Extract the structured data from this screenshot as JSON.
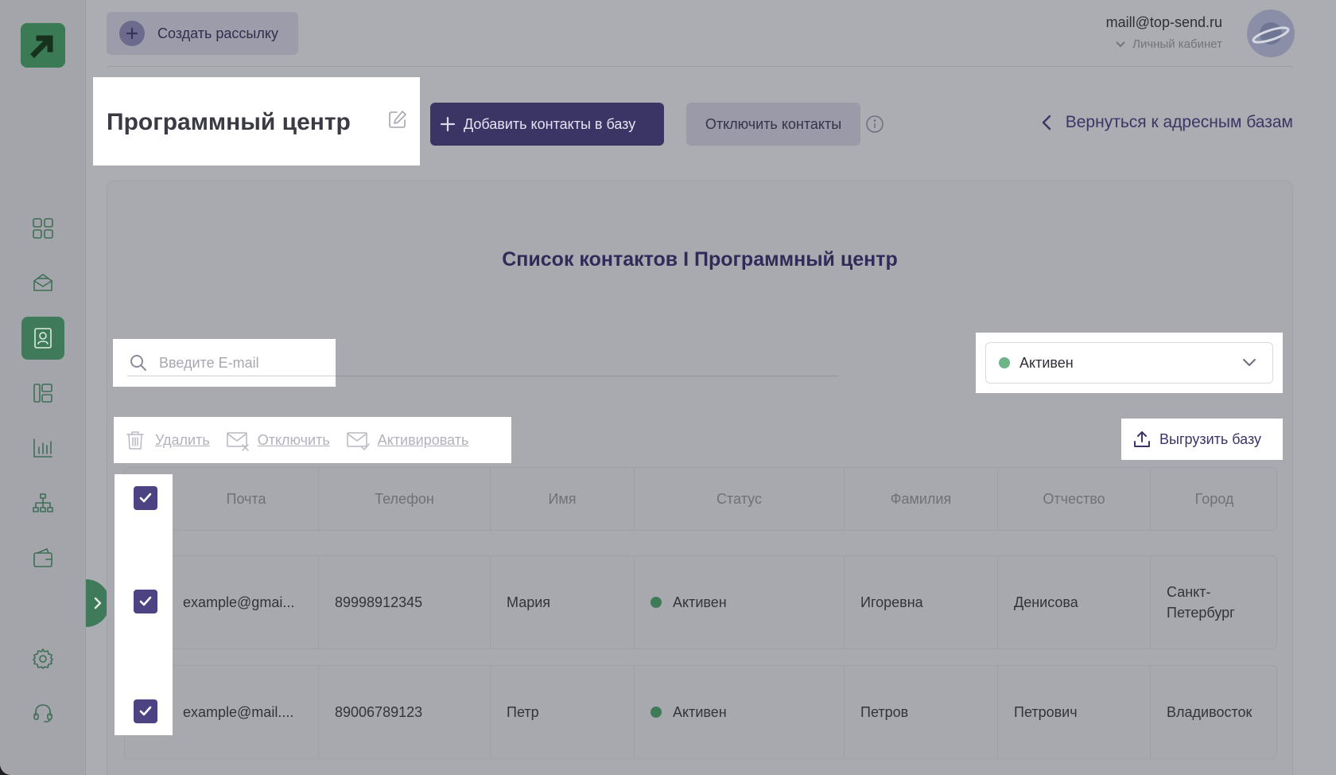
{
  "header": {
    "create_button": "Создать рассылку",
    "user_email": "maill@top-send.ru",
    "cabinet_label": "Личный кабинет"
  },
  "page": {
    "title": "Программный центр",
    "add_button": "Добавить контакты в базу",
    "disable_button": "Отключить контакты",
    "back_link": "Вернуться к адресным базам",
    "list_title": "Список контактов I Программный центр"
  },
  "search": {
    "placeholder": "Введите E-mail",
    "value": ""
  },
  "status_filter": {
    "selected": "Активен"
  },
  "actions": {
    "delete": "Удалить",
    "disable": "Отключить",
    "activate": "Активировать",
    "export": "Выгрузить базу"
  },
  "table": {
    "columns": [
      "Почта",
      "Телефон",
      "Имя",
      "Статус",
      "Фамилия",
      "Отчество",
      "Город"
    ],
    "rows": [
      {
        "email": "example@gmai...",
        "phone": "89998912345",
        "first_name": "Мария",
        "status": "Активен",
        "last_name": "Игоревна",
        "patronymic": "Денисова",
        "city": "Санкт-Петербург"
      },
      {
        "email": "example@mail....",
        "phone": "89006789123",
        "first_name": "Петр",
        "status": "Активен",
        "last_name": "Петров",
        "patronymic": "Петрович",
        "city": "Владивосток"
      }
    ]
  },
  "colors": {
    "accent": "#3b3566",
    "brand_green": "#3f7b5a",
    "status_active": "#3e7a55"
  },
  "icons": [
    "logo-arrow-icon",
    "dashboard-icon",
    "mail-icon",
    "contacts-icon",
    "templates-icon",
    "stats-icon",
    "hierarchy-icon",
    "wallet-icon",
    "settings-icon",
    "support-icon",
    "chevron-right-icon"
  ]
}
